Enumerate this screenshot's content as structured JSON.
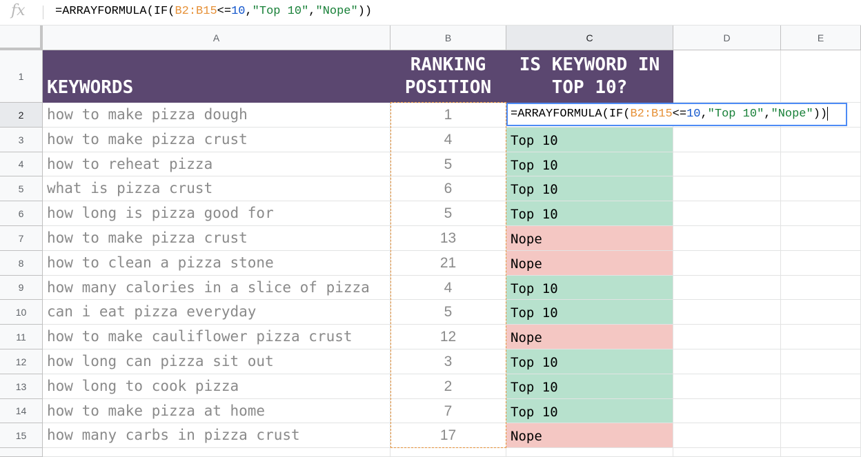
{
  "formula_bar": {
    "fx_label": "fx",
    "prefix": "=ARRAYFORMULA(IF(",
    "range": "B2:B15",
    "op": "<=",
    "num": "10",
    "comma1": ",",
    "str1": "\"Top 10\"",
    "comma2": ",",
    "str2": "\"Nope\"",
    "suffix": "))"
  },
  "columns": [
    "A",
    "B",
    "C",
    "D",
    "E"
  ],
  "row_numbers": [
    "1",
    "2",
    "3",
    "4",
    "5",
    "6",
    "7",
    "8",
    "9",
    "10",
    "11",
    "12",
    "13",
    "14",
    "15"
  ],
  "header": {
    "keywords": "KEYWORDS",
    "ranking_line1": "RANKING",
    "ranking_line2": "POSITION",
    "top10_line1": "IS KEYWORD IN",
    "top10_line2": "TOP 10?"
  },
  "rows": [
    {
      "keyword": "how to make pizza dough",
      "rank": "1",
      "result": ""
    },
    {
      "keyword": "how to make pizza crust",
      "rank": "4",
      "result": "Top 10"
    },
    {
      "keyword": "how to reheat pizza",
      "rank": "5",
      "result": "Top 10"
    },
    {
      "keyword": "what is pizza crust",
      "rank": "6",
      "result": "Top 10"
    },
    {
      "keyword": "how long is pizza good for",
      "rank": "5",
      "result": "Top 10"
    },
    {
      "keyword": "how to make pizza crust",
      "rank": "13",
      "result": "Nope"
    },
    {
      "keyword": "how to clean a pizza stone",
      "rank": "21",
      "result": "Nope"
    },
    {
      "keyword": "how many calories in a slice of pizza",
      "rank": "4",
      "result": "Top 10"
    },
    {
      "keyword": "can i eat pizza everyday",
      "rank": "5",
      "result": "Top 10"
    },
    {
      "keyword": "how to make cauliflower pizza crust",
      "rank": "12",
      "result": "Nope"
    },
    {
      "keyword": "how long can pizza sit out",
      "rank": "3",
      "result": "Top 10"
    },
    {
      "keyword": "how long to cook pizza",
      "rank": "2",
      "result": "Top 10"
    },
    {
      "keyword": "how to make pizza at home",
      "rank": "7",
      "result": "Top 10"
    },
    {
      "keyword": "how many carbs in pizza crust",
      "rank": "17",
      "result": "Nope"
    }
  ],
  "colors": {
    "header_bg": "#5b4770",
    "top10_bg": "#b7e1cd",
    "nope_bg": "#f4c7c3",
    "range_highlight": "#e69138",
    "active_cell_border": "#4d8bf5"
  }
}
